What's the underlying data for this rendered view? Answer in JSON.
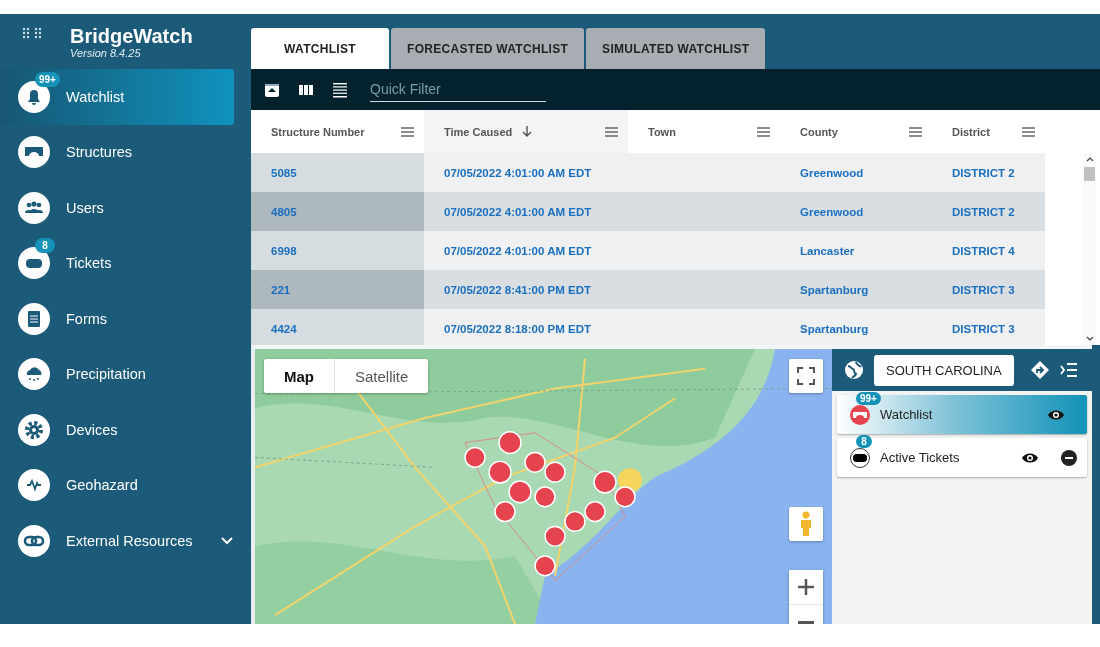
{
  "app": {
    "title": "BridgeWatch",
    "version": "Version 8.4.25"
  },
  "sidebar": {
    "items": [
      {
        "label": "Watchlist",
        "selected": true,
        "badge": "99+"
      },
      {
        "label": "Structures",
        "selected": false
      },
      {
        "label": "Users",
        "selected": false
      },
      {
        "label": "Tickets",
        "selected": false,
        "badge": "8"
      },
      {
        "label": "Forms",
        "selected": false
      },
      {
        "label": "Precipitation",
        "selected": false
      },
      {
        "label": "Devices",
        "selected": false
      },
      {
        "label": "Geohazard",
        "selected": false
      },
      {
        "label": "External Resources",
        "selected": false,
        "expanded": false
      }
    ]
  },
  "tabs": [
    {
      "label": "WATCHLIST",
      "selected": true
    },
    {
      "label": "FORECASTED WATCHLIST",
      "selected": false
    },
    {
      "label": "SIMULATED WATCHLIST",
      "selected": false
    }
  ],
  "toolbar": {
    "filter": {
      "placeholder": "Quick Filter"
    }
  },
  "table": {
    "columns": [
      {
        "label": "Structure Number",
        "sorted": false
      },
      {
        "label": "Time Caused",
        "sorted": true
      },
      {
        "label": "Town",
        "sorted": false
      },
      {
        "label": "County",
        "sorted": false
      },
      {
        "label": "District",
        "sorted": false
      }
    ],
    "rows": [
      [
        "5085",
        "07/05/2022 4:01:00 AM EDT",
        "",
        "Greenwood",
        "DISTRICT 2"
      ],
      [
        "4805",
        "07/05/2022 4:01:00 AM EDT",
        "",
        "Greenwood",
        "DISTRICT 2"
      ],
      [
        "6998",
        "07/05/2022 4:01:00 AM EDT",
        "",
        "Lancaster",
        "DISTRICT 4"
      ],
      [
        "221",
        "07/05/2022 8:41:00 PM EDT",
        "",
        "Spartanburg",
        "DISTRICT 3"
      ],
      [
        "4424",
        "07/05/2022 8:18:00 PM EDT",
        "",
        "Spartanburg",
        "DISTRICT 3"
      ]
    ]
  },
  "map": {
    "map_types": [
      {
        "label": "Map",
        "selected": true
      },
      {
        "label": "Satellite",
        "selected": false
      }
    ]
  },
  "layers_panel": {
    "region": "SOUTH CAROLINA",
    "layers": [
      {
        "label": "Watchlist",
        "badge": "99+",
        "selected": true,
        "kind": "structure",
        "removable": false
      },
      {
        "label": "Active Tickets",
        "badge": "8",
        "selected": false,
        "kind": "ticket",
        "removable": true
      }
    ]
  }
}
